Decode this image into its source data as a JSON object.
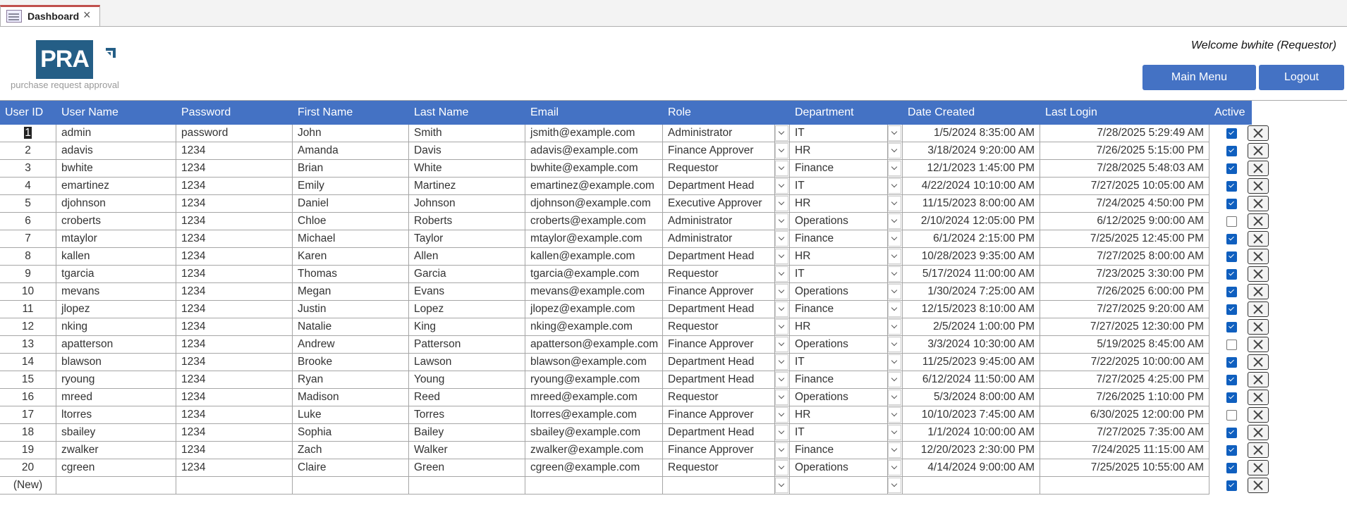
{
  "tab": {
    "label": "Dashboard",
    "icon": "form-icon"
  },
  "logo": {
    "text": "PRA",
    "subtitle": "purchase request approval"
  },
  "header": {
    "welcome": "Welcome bwhite (Requestor)",
    "main_menu": "Main Menu",
    "logout": "Logout"
  },
  "colors": {
    "accent": "#4472C4",
    "logo": "#245E86",
    "checkbox": "#0F5FBF"
  },
  "columns": [
    "User ID",
    "User Name",
    "Password",
    "First Name",
    "Last Name",
    "Email",
    "Role",
    "Department",
    "Date Created",
    "Last Login",
    "Active"
  ],
  "rows": [
    {
      "id": "1",
      "user": "admin",
      "pw": "password",
      "first": "John",
      "last": "Smith",
      "email": "jsmith@example.com",
      "role": "Administrator",
      "dept": "IT",
      "created": "1/5/2024 8:35:00 AM",
      "login": "7/28/2025 5:29:49 AM",
      "active": true
    },
    {
      "id": "2",
      "user": "adavis",
      "pw": "1234",
      "first": "Amanda",
      "last": "Davis",
      "email": "adavis@example.com",
      "role": "Finance Approver",
      "dept": "HR",
      "created": "3/18/2024 9:20:00 AM",
      "login": "7/26/2025 5:15:00 PM",
      "active": true
    },
    {
      "id": "3",
      "user": "bwhite",
      "pw": "1234",
      "first": "Brian",
      "last": "White",
      "email": "bwhite@example.com",
      "role": "Requestor",
      "dept": "Finance",
      "created": "12/1/2023 1:45:00 PM",
      "login": "7/28/2025 5:48:03 AM",
      "active": true
    },
    {
      "id": "4",
      "user": "emartinez",
      "pw": "1234",
      "first": "Emily",
      "last": "Martinez",
      "email": "emartinez@example.com",
      "role": "Department Head",
      "dept": "IT",
      "created": "4/22/2024 10:10:00 AM",
      "login": "7/27/2025 10:05:00 AM",
      "active": true
    },
    {
      "id": "5",
      "user": "djohnson",
      "pw": "1234",
      "first": "Daniel",
      "last": "Johnson",
      "email": "djohnson@example.com",
      "role": "Executive Approver",
      "dept": "HR",
      "created": "11/15/2023 8:00:00 AM",
      "login": "7/24/2025 4:50:00 PM",
      "active": true
    },
    {
      "id": "6",
      "user": "croberts",
      "pw": "1234",
      "first": "Chloe",
      "last": "Roberts",
      "email": "croberts@example.com",
      "role": "Administrator",
      "dept": "Operations",
      "created": "2/10/2024 12:05:00 PM",
      "login": "6/12/2025 9:00:00 AM",
      "active": false
    },
    {
      "id": "7",
      "user": "mtaylor",
      "pw": "1234",
      "first": "Michael",
      "last": "Taylor",
      "email": "mtaylor@example.com",
      "role": "Administrator",
      "dept": "Finance",
      "created": "6/1/2024 2:15:00 PM",
      "login": "7/25/2025 12:45:00 PM",
      "active": true
    },
    {
      "id": "8",
      "user": "kallen",
      "pw": "1234",
      "first": "Karen",
      "last": "Allen",
      "email": "kallen@example.com",
      "role": "Department Head",
      "dept": "HR",
      "created": "10/28/2023 9:35:00 AM",
      "login": "7/27/2025 8:00:00 AM",
      "active": true
    },
    {
      "id": "9",
      "user": "tgarcia",
      "pw": "1234",
      "first": "Thomas",
      "last": "Garcia",
      "email": "tgarcia@example.com",
      "role": "Requestor",
      "dept": "IT",
      "created": "5/17/2024 11:00:00 AM",
      "login": "7/23/2025 3:30:00 PM",
      "active": true
    },
    {
      "id": "10",
      "user": "mevans",
      "pw": "1234",
      "first": "Megan",
      "last": "Evans",
      "email": "mevans@example.com",
      "role": "Finance Approver",
      "dept": "Operations",
      "created": "1/30/2024 7:25:00 AM",
      "login": "7/26/2025 6:00:00 PM",
      "active": true
    },
    {
      "id": "11",
      "user": "jlopez",
      "pw": "1234",
      "first": "Justin",
      "last": "Lopez",
      "email": "jlopez@example.com",
      "role": "Department Head",
      "dept": "Finance",
      "created": "12/15/2023 8:10:00 AM",
      "login": "7/27/2025 9:20:00 AM",
      "active": true
    },
    {
      "id": "12",
      "user": "nking",
      "pw": "1234",
      "first": "Natalie",
      "last": "King",
      "email": "nking@example.com",
      "role": "Requestor",
      "dept": "HR",
      "created": "2/5/2024 1:00:00 PM",
      "login": "7/27/2025 12:30:00 PM",
      "active": true
    },
    {
      "id": "13",
      "user": "apatterson",
      "pw": "1234",
      "first": "Andrew",
      "last": "Patterson",
      "email": "apatterson@example.com",
      "role": "Finance Approver",
      "dept": "Operations",
      "created": "3/3/2024 10:30:00 AM",
      "login": "5/19/2025 8:45:00 AM",
      "active": false
    },
    {
      "id": "14",
      "user": "blawson",
      "pw": "1234",
      "first": "Brooke",
      "last": "Lawson",
      "email": "blawson@example.com",
      "role": "Department Head",
      "dept": "IT",
      "created": "11/25/2023 9:45:00 AM",
      "login": "7/22/2025 10:00:00 AM",
      "active": true
    },
    {
      "id": "15",
      "user": "ryoung",
      "pw": "1234",
      "first": "Ryan",
      "last": "Young",
      "email": "ryoung@example.com",
      "role": "Department Head",
      "dept": "Finance",
      "created": "6/12/2024 11:50:00 AM",
      "login": "7/27/2025 4:25:00 PM",
      "active": true
    },
    {
      "id": "16",
      "user": "mreed",
      "pw": "1234",
      "first": "Madison",
      "last": "Reed",
      "email": "mreed@example.com",
      "role": "Requestor",
      "dept": "Operations",
      "created": "5/3/2024 8:00:00 AM",
      "login": "7/26/2025 1:10:00 PM",
      "active": true
    },
    {
      "id": "17",
      "user": "ltorres",
      "pw": "1234",
      "first": "Luke",
      "last": "Torres",
      "email": "ltorres@example.com",
      "role": "Finance Approver",
      "dept": "HR",
      "created": "10/10/2023 7:45:00 AM",
      "login": "6/30/2025 12:00:00 PM",
      "active": false
    },
    {
      "id": "18",
      "user": "sbailey",
      "pw": "1234",
      "first": "Sophia",
      "last": "Bailey",
      "email": "sbailey@example.com",
      "role": "Department Head",
      "dept": "IT",
      "created": "1/1/2024 10:00:00 AM",
      "login": "7/27/2025 7:35:00 AM",
      "active": true
    },
    {
      "id": "19",
      "user": "zwalker",
      "pw": "1234",
      "first": "Zach",
      "last": "Walker",
      "email": "zwalker@example.com",
      "role": "Finance Approver",
      "dept": "Finance",
      "created": "12/20/2023 2:30:00 PM",
      "login": "7/24/2025 11:15:00 AM",
      "active": true
    },
    {
      "id": "20",
      "user": "cgreen",
      "pw": "1234",
      "first": "Claire",
      "last": "Green",
      "email": "cgreen@example.com",
      "role": "Requestor",
      "dept": "Operations",
      "created": "4/14/2024 9:00:00 AM",
      "login": "7/25/2025 10:55:00 AM",
      "active": true
    },
    {
      "id": "(New)",
      "user": "",
      "pw": "",
      "first": "",
      "last": "",
      "email": "",
      "role": "",
      "dept": "",
      "created": "",
      "login": "",
      "active": true
    }
  ]
}
